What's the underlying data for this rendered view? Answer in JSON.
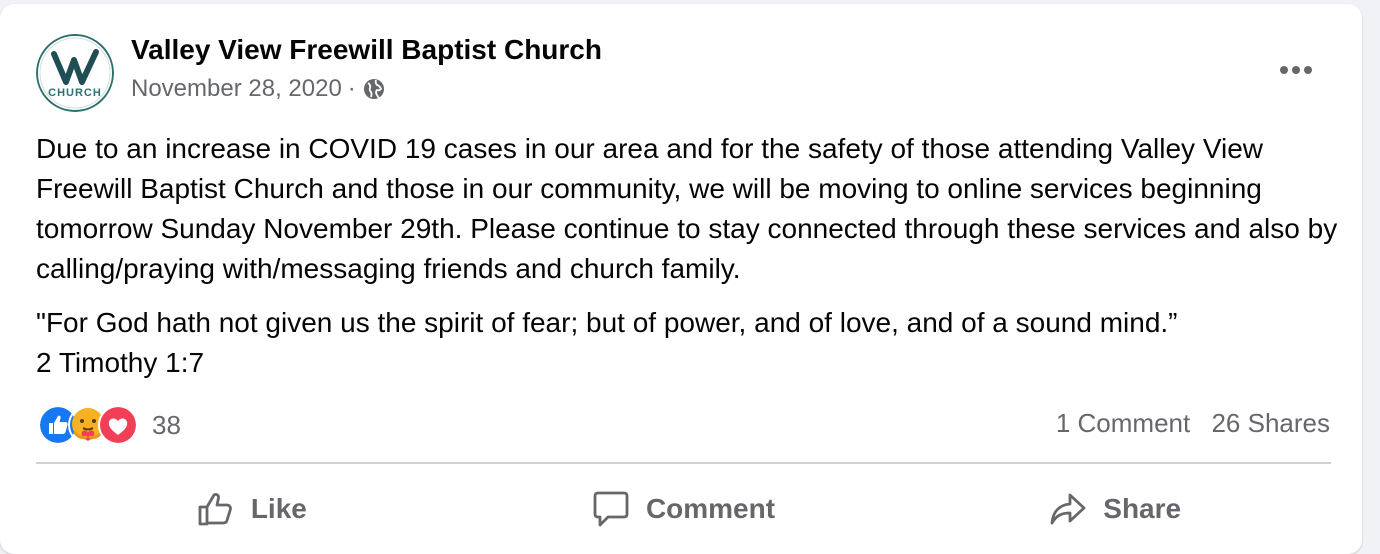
{
  "post": {
    "author": "Valley View Freewill Baptist Church",
    "avatar_text": "CHURCH",
    "avatar_monogram": "VV",
    "date": "November 28, 2020",
    "separator": "·",
    "privacy_icon": "globe-icon",
    "more_icon": "ellipsis-icon",
    "paragraphs": [
      "Due to an increase in COVID 19 cases in our area and for the safety of those attending Valley View Freewill Baptist Church and those in our community, we will be moving to online services beginning tomorrow Sunday November 29th. Please continue to stay connected through these services and also by calling/praying with/messaging friends and church family.",
      "\"For God hath not given us the spirit of fear; but of power, and of love, and of a sound mind.”\n2 Timothy 1:7"
    ]
  },
  "engagement": {
    "reactions": [
      "like-reaction-icon",
      "care-reaction-icon",
      "love-reaction-icon"
    ],
    "reaction_count": "38",
    "comments": "1 Comment",
    "shares": "26 Shares"
  },
  "actions": {
    "like": "Like",
    "comment": "Comment",
    "share": "Share"
  },
  "colors": {
    "like_blue": "#1877f2",
    "love_red": "#f33e58",
    "care_yellow": "#f7b125",
    "brand_teal": "#2f6f6d",
    "secondary_text": "#65676b"
  }
}
